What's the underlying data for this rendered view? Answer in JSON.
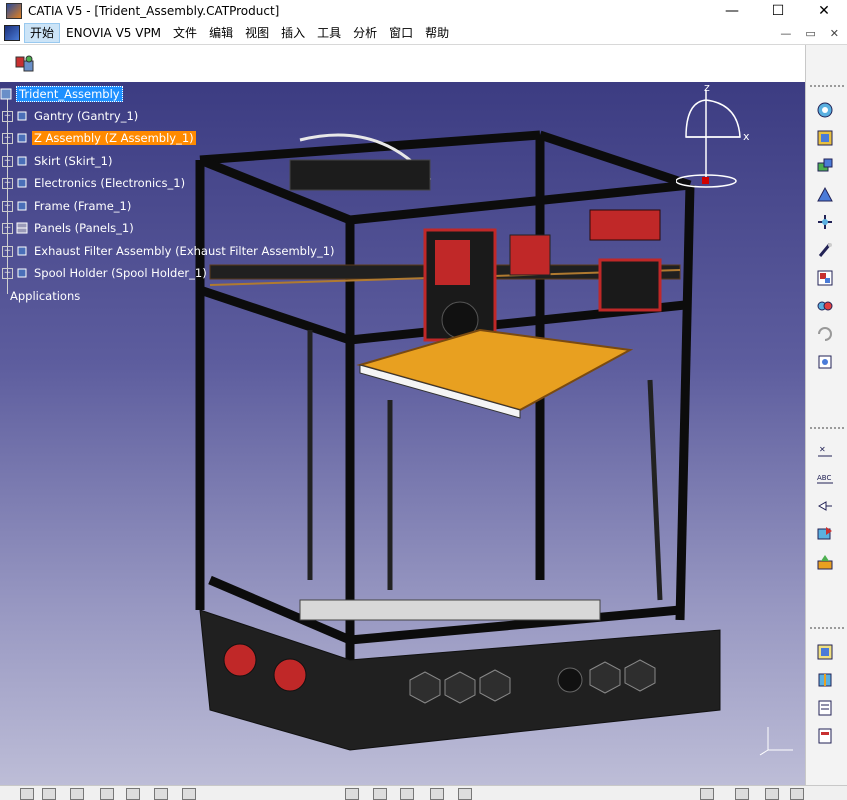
{
  "window": {
    "app_icon": "catia-app-icon",
    "title": "CATIA V5 - [Trident_Assembly.CATProduct]",
    "minimize": "—",
    "maximize": "☐",
    "close": "✕"
  },
  "menu": {
    "items": [
      "开始",
      "ENOVIA V5 VPM",
      "文件",
      "编辑",
      "视图",
      "插入",
      "工具",
      "分析",
      "窗口",
      "帮助"
    ],
    "active_index": 0,
    "doc_controls": [
      "—",
      "▭",
      "✕"
    ]
  },
  "tree": {
    "root": "Trident_Assembly",
    "children": [
      {
        "label": "Gantry (Gantry_1)",
        "icon": "component-icon"
      },
      {
        "label": "Z Assembly (Z Assembly_1)",
        "icon": "component-icon",
        "highlight": true
      },
      {
        "label": "Skirt (Skirt_1)",
        "icon": "component-icon"
      },
      {
        "label": "Electronics (Electronics_1)",
        "icon": "component-icon"
      },
      {
        "label": "Frame (Frame_1)",
        "icon": "component-icon"
      },
      {
        "label": "Panels (Panels_1)",
        "icon": "part-icon"
      },
      {
        "label": "Exhaust Filter Assembly (Exhaust Filter Assembly_1)",
        "icon": "component-icon"
      },
      {
        "label": "Spool Holder (Spool Holder_1)",
        "icon": "component-icon"
      }
    ],
    "applications": "Applications"
  },
  "compass": {
    "x": "x",
    "z": "z"
  },
  "colors": {
    "selection_blue": "#1e90ff",
    "highlight_orange": "#ff8a00",
    "bg_top": "#3c3c82",
    "bg_bottom": "#bdbdd7",
    "frame_black": "#141414",
    "bed_orange": "#e8a020",
    "accent_red": "#d21e1e"
  }
}
